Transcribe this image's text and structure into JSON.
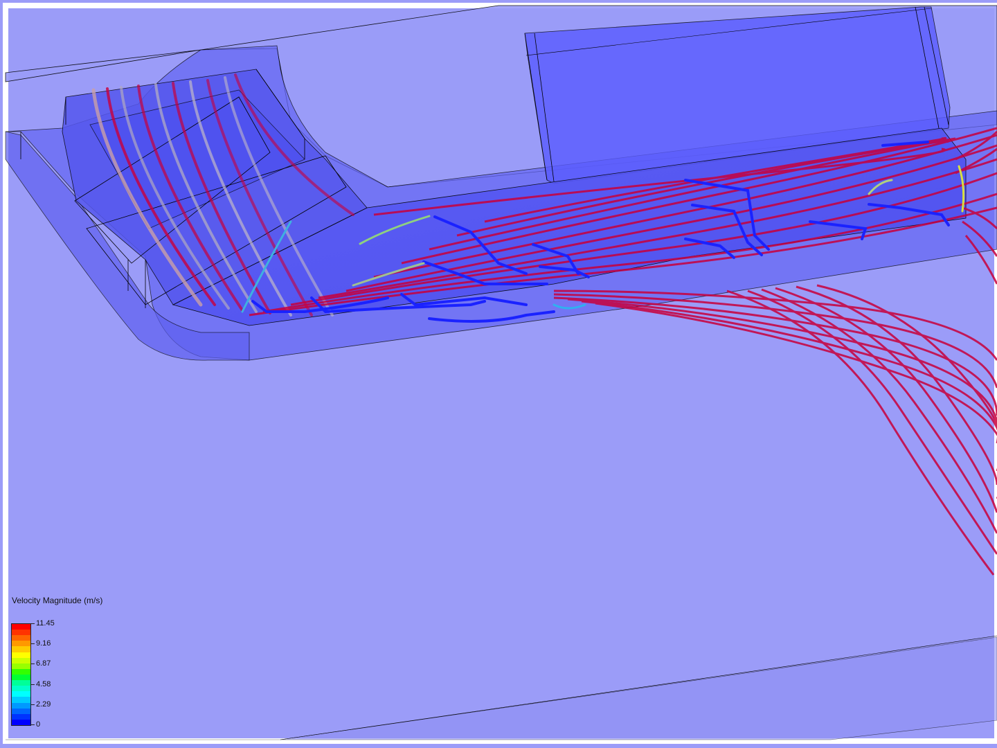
{
  "legend": {
    "title": "Velocity Magnitude (m/s)",
    "ticks": [
      "11.45",
      "9.16",
      "6.87",
      "4.58",
      "2.29",
      "0"
    ],
    "colors": [
      "#ff0000",
      "#ff3300",
      "#ff6600",
      "#ff9900",
      "#ffcc00",
      "#ffff00",
      "#ccff00",
      "#99ff00",
      "#33ff00",
      "#00ff33",
      "#00ff99",
      "#00ffcc",
      "#00ffff",
      "#00ccff",
      "#0099ff",
      "#0066ff",
      "#0033ff",
      "#0000ff"
    ]
  },
  "scene": {
    "background_color": "#9b9cf8",
    "geometry_color": "#6a6cff",
    "streamline_color": "#c8003c",
    "wireframe_color": "#000000"
  }
}
